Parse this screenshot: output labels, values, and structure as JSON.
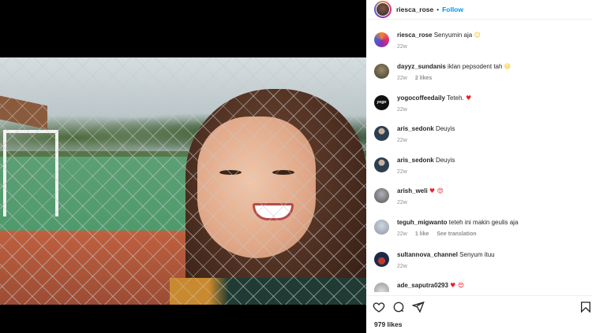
{
  "post": {
    "author": "riesca_rose",
    "follow_label": "Follow",
    "separator": "•",
    "caption": {
      "user": "riesca_rose",
      "text": "Senyumin aja",
      "emoji": "☺",
      "time": "22w"
    },
    "likes_label": "979 likes"
  },
  "comments": [
    {
      "user": "dayyz_sundanis",
      "text": "iklan pepsodent tah",
      "emoji": "😆",
      "time": "22w",
      "likes": "2 likes",
      "extra": ""
    },
    {
      "user": "yogocoffeedaily",
      "text": "Teteh.",
      "emoji": "♥",
      "time": "22w",
      "likes": "",
      "extra": ""
    },
    {
      "user": "aris_sedonk",
      "text": "Deuyis",
      "emoji": "",
      "time": "22w",
      "likes": "",
      "extra": ""
    },
    {
      "user": "aris_sedonk",
      "text": "Deuyis",
      "emoji": "",
      "time": "22w",
      "likes": "",
      "extra": ""
    },
    {
      "user": "arish_weli",
      "text": "",
      "emoji": "♥ 😍",
      "time": "22w",
      "likes": "",
      "extra": ""
    },
    {
      "user": "teguh_migwanto",
      "text": "teteh ini makin geulis aja",
      "emoji": "",
      "time": "22w",
      "likes": "1 like",
      "extra": "See translation"
    },
    {
      "user": "sultannova_channel",
      "text": "Senyum ituu",
      "emoji": "",
      "time": "22w",
      "likes": "",
      "extra": ""
    },
    {
      "user": "ade_saputra0293",
      "text": "",
      "emoji": "♥ 😍",
      "time": "",
      "likes": "",
      "extra": ""
    }
  ],
  "avatar_labels": {
    "yogo": "yogo"
  },
  "icons": [
    "heart-icon",
    "comment-icon",
    "share-icon",
    "bookmark-icon"
  ],
  "colors": {
    "follow": "#0095f6",
    "heart": "#ed1c24",
    "meta": "#8e8e8e"
  }
}
